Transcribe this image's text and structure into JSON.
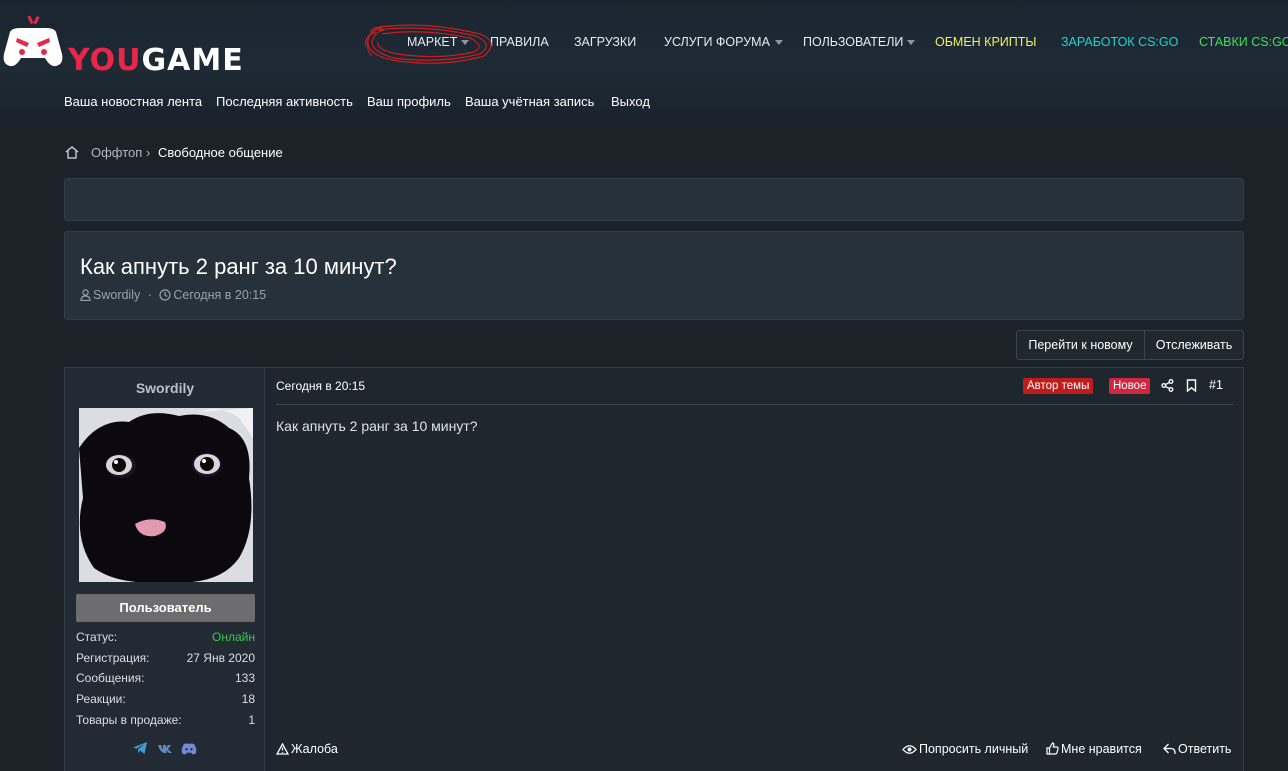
{
  "header": {
    "logo": {
      "prefix": "YOU",
      "suffix": "GAME"
    },
    "nav": [
      {
        "label": "МАРКЕТ",
        "dropdown": true,
        "color": "#e6ebef"
      },
      {
        "label": "ПРАВИЛА",
        "dropdown": false,
        "color": "#e6ebef"
      },
      {
        "label": "ЗАГРУЗКИ",
        "dropdown": false,
        "color": "#e6ebef"
      },
      {
        "label": "УСЛУГИ ФОРУМА",
        "dropdown": true,
        "color": "#e6ebef"
      },
      {
        "label": "ПОЛЬЗОВАТЕЛИ",
        "dropdown": true,
        "color": "#e6ebef"
      },
      {
        "label": "ОБМЕН КРИПТЫ",
        "dropdown": false,
        "color": "#f2f05a"
      },
      {
        "label": "ЗАРАБОТОК CS:GO",
        "dropdown": false,
        "color": "#22d3d0"
      },
      {
        "label": "СТАВКИ CS:GO",
        "dropdown": false,
        "color": "#3ee25a"
      }
    ],
    "subnav": [
      "Ваша новостная лента",
      "Последняя активность",
      "Ваш профиль",
      "Ваша учётная запись",
      "Выход"
    ]
  },
  "breadcrumb": {
    "home_icon": "home-icon",
    "items": [
      "Оффтоп",
      "Свободное общение"
    ]
  },
  "thread": {
    "title": "Как апнуть 2 ранг за 10 минут?",
    "author": "Swordily",
    "date": "Сегодня в 20:15"
  },
  "actions": {
    "go_new": "Перейти к новому",
    "watch": "Отслеживать"
  },
  "post": {
    "username": "Swordily",
    "role": "Пользователь",
    "stats": [
      {
        "label": "Статус:",
        "value": "Онлайн",
        "online": true
      },
      {
        "label": "Регистрация:",
        "value": "27 Янв 2020"
      },
      {
        "label": "Сообщения:",
        "value": "133"
      },
      {
        "label": "Реакции:",
        "value": "18"
      },
      {
        "label": "Товары в продаже:",
        "value": "1"
      }
    ],
    "socials": [
      "telegram-icon",
      "vk-icon",
      "discord-icon"
    ],
    "date": "Сегодня в 20:15",
    "tag_author": "Автор темы",
    "tag_new": "Новое",
    "number": "#1",
    "body": "Как апнуть 2 ранг за 10 минут?",
    "footer": {
      "report": "Жалоба",
      "ask_private": "Попросить личный",
      "like": "Мне нравится",
      "reply": "Ответить"
    }
  },
  "colors": {
    "accent_red": "#e8264b",
    "tag_author_bg": "#c01c1c",
    "tag_new_bg": "#d0263f",
    "online": "#39c94a"
  }
}
